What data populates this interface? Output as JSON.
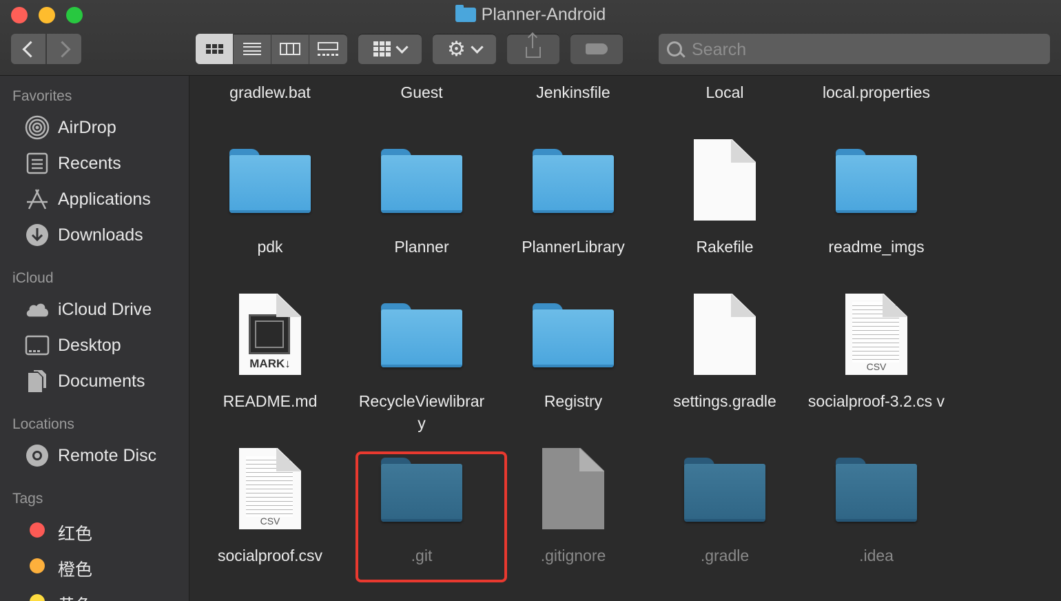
{
  "window": {
    "title": "Planner-Android"
  },
  "toolbar": {
    "back": "back",
    "forward": "forward",
    "views": [
      "icon-view",
      "list-view",
      "column-view",
      "gallery-view"
    ],
    "search_placeholder": "Search"
  },
  "sidebar": {
    "favorites_header": "Favorites",
    "favorites": [
      {
        "label": "AirDrop",
        "icon": "airdrop-icon"
      },
      {
        "label": "Recents",
        "icon": "recents-icon"
      },
      {
        "label": "Applications",
        "icon": "applications-icon"
      },
      {
        "label": "Downloads",
        "icon": "downloads-icon"
      }
    ],
    "icloud_header": "iCloud",
    "icloud": [
      {
        "label": "iCloud Drive",
        "icon": "cloud-icon"
      },
      {
        "label": "Desktop",
        "icon": "desktop-icon"
      },
      {
        "label": "Documents",
        "icon": "documents-icon"
      }
    ],
    "locations_header": "Locations",
    "locations": [
      {
        "label": "Remote Disc",
        "icon": "disc-icon"
      }
    ],
    "tags_header": "Tags",
    "tags": [
      {
        "label": "红色",
        "color": "#fc5a55"
      },
      {
        "label": "橙色",
        "color": "#fdb03c"
      },
      {
        "label": "黄色",
        "color": "#fedc40"
      }
    ]
  },
  "files": {
    "row0": [
      "gradlew.bat",
      "Guest",
      "Jenkinsfile",
      "Local",
      "local.properties"
    ],
    "row1": [
      {
        "name": "pdk",
        "kind": "folder"
      },
      {
        "name": "Planner",
        "kind": "folder"
      },
      {
        "name": "PlannerLibrary",
        "kind": "folder"
      },
      {
        "name": "Rakefile",
        "kind": "document"
      },
      {
        "name": "readme_imgs",
        "kind": "folder"
      }
    ],
    "row2": [
      {
        "name": "README.md",
        "kind": "markdown",
        "badge": "MARK↓"
      },
      {
        "name": "RecycleViewlibrar y",
        "kind": "folder"
      },
      {
        "name": "Registry",
        "kind": "folder"
      },
      {
        "name": "settings.gradle",
        "kind": "document"
      },
      {
        "name": "socialproof-3.2.cs v",
        "kind": "csv",
        "badge": "CSV"
      }
    ],
    "row3": [
      {
        "name": "socialproof.csv",
        "kind": "csv",
        "badge": "CSV"
      },
      {
        "name": ".git",
        "kind": "folder-hidden"
      },
      {
        "name": ".gitignore",
        "kind": "document-hidden"
      },
      {
        "name": ".gradle",
        "kind": "folder-hidden"
      },
      {
        "name": ".idea",
        "kind": "folder-hidden"
      }
    ]
  },
  "colors": {
    "highlight": "#e8392f",
    "folder": "#4aa5dd",
    "sidebar": "#333335"
  }
}
